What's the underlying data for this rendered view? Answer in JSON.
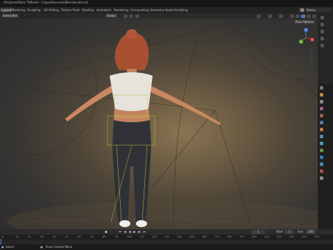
{
  "window_title": "...\\Projects\\Pack 7\\Model - Copie\\Sources\\Blender.blend]",
  "workspace_tabs": [
    "Layout",
    "Modeling",
    "Sculpting",
    "UV Editing",
    "Texture Paint",
    "Shading",
    "Animation",
    "Rendering",
    "Compositing",
    "Geometry Nodes",
    "Scripting"
  ],
  "active_tab": "Layout",
  "scene_label": "Scene",
  "viewport": {
    "select_mode": "Select Box",
    "transform_orientation": "Global",
    "pose_options": "Pose Options",
    "shading_mode_active": "solid-shading-icon",
    "axis_gizmo": {
      "x": "X",
      "y": "Y",
      "z": "Z"
    }
  },
  "timeline": {
    "current_frame": "1",
    "start_label": "Start",
    "start_value": "1",
    "end_label": "End",
    "end_value": "250",
    "ruler_ticks": [
      "0",
      "10",
      "20",
      "30",
      "40",
      "50",
      "60",
      "70",
      "80",
      "90",
      "100",
      "110",
      "120",
      "130",
      "140",
      "150",
      "160",
      "170",
      "180",
      "190",
      "200",
      "210",
      "220",
      "230",
      "240",
      "250"
    ]
  },
  "status": {
    "left": "Select",
    "right": "Pose Context Menu"
  },
  "colors": {
    "accent": "#4d7bb8",
    "playhead": "#4d8fe0",
    "hair": "#a8502f",
    "top": "#e6e3dc",
    "jeans": "#2f3137"
  }
}
